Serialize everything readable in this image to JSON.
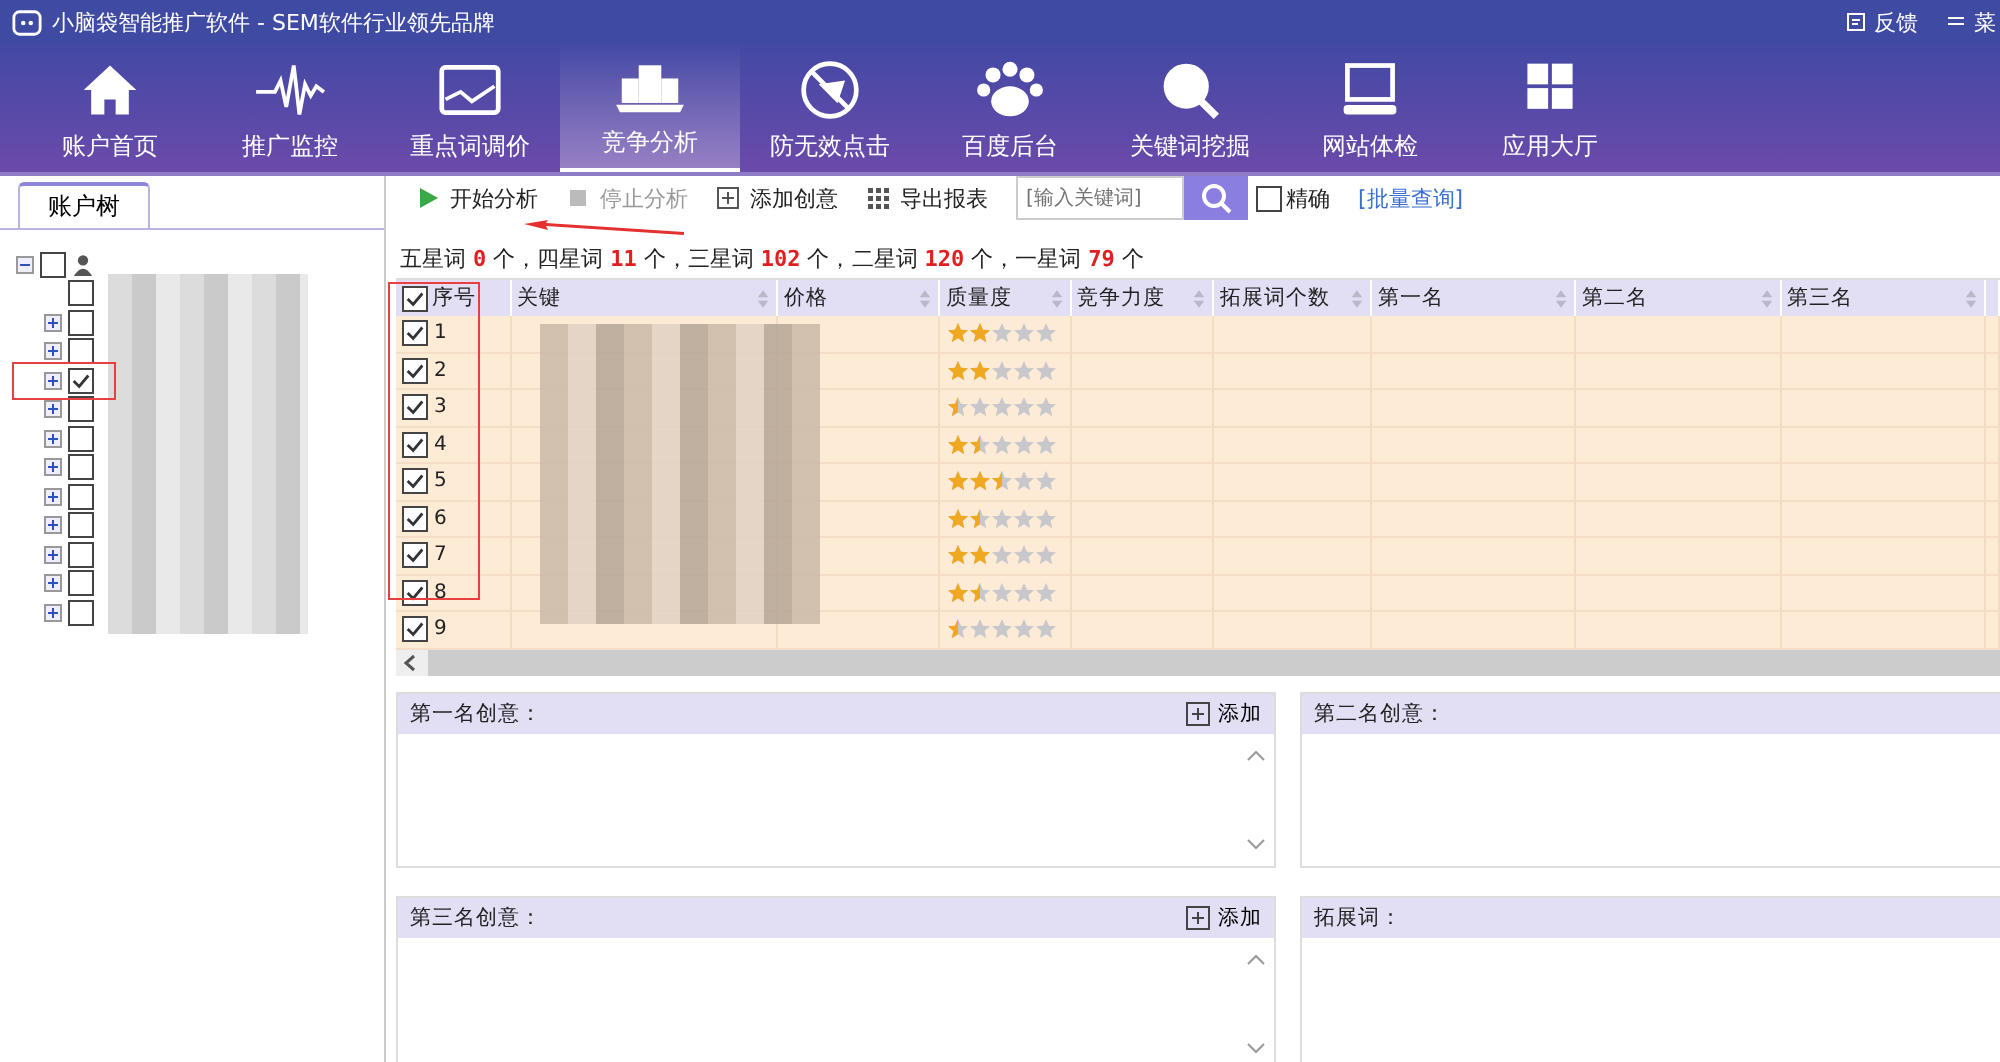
{
  "window": {
    "title": "小脑袋智能推广软件 - SEM软件行业领先品牌",
    "actions": [
      {
        "kind": "feedback",
        "label": "反馈"
      },
      {
        "kind": "menu",
        "label": "菜"
      }
    ]
  },
  "nav": [
    {
      "kind": "home",
      "label": "账户首页",
      "selected": false
    },
    {
      "kind": "pulse",
      "label": "推广监控",
      "selected": false
    },
    {
      "kind": "chart",
      "label": "重点词调价",
      "selected": false
    },
    {
      "kind": "podium",
      "label": "竞争分析",
      "selected": true
    },
    {
      "kind": "noclick",
      "label": "防无效点击",
      "selected": false
    },
    {
      "kind": "paw",
      "label": "百度后台",
      "selected": false
    },
    {
      "kind": "search",
      "label": "关键词挖掘",
      "selected": false
    },
    {
      "kind": "monitor",
      "label": "网站体检",
      "selected": false
    },
    {
      "kind": "apps",
      "label": "应用大厅",
      "selected": false
    }
  ],
  "sidebar": {
    "tab": "账户树",
    "root_checked": false,
    "items": [
      {
        "expandable": false,
        "checked": false
      },
      {
        "expandable": true,
        "checked": false
      },
      {
        "expandable": true,
        "checked": false
      },
      {
        "expandable": true,
        "checked": true
      },
      {
        "expandable": true,
        "checked": false
      },
      {
        "expandable": true,
        "checked": false
      },
      {
        "expandable": true,
        "checked": false
      },
      {
        "expandable": true,
        "checked": false
      },
      {
        "expandable": true,
        "checked": false
      },
      {
        "expandable": true,
        "checked": false
      },
      {
        "expandable": true,
        "checked": false
      },
      {
        "expandable": true,
        "checked": false
      }
    ]
  },
  "toolbar": {
    "buttons": [
      {
        "kind": "play",
        "label": "开始分析",
        "disabled": false
      },
      {
        "kind": "stop",
        "label": "停止分析",
        "disabled": true
      },
      {
        "kind": "add",
        "label": "添加创意",
        "disabled": false
      },
      {
        "kind": "grid",
        "label": "导出报表",
        "disabled": false
      }
    ],
    "search": {
      "placeholder": "[输入关键词]"
    },
    "exact": {
      "label": "精确",
      "checked": false
    },
    "batch_link": "[批量查询]"
  },
  "summary": [
    {
      "label": "五星词",
      "count": "0",
      "unit": "个，"
    },
    {
      "label": "四星词",
      "count": "11",
      "unit": "个，"
    },
    {
      "label": "三星词",
      "count": "102",
      "unit": "个，"
    },
    {
      "label": "二星词",
      "count": "120",
      "unit": "个，"
    },
    {
      "label": "一星词",
      "count": "79",
      "unit": "个"
    }
  ],
  "table": {
    "all_checked": true,
    "columns": [
      "序号",
      "关键",
      "价格",
      "质量度",
      "竞争力度",
      "拓展词个数",
      "第一名",
      "第二名",
      "第三名"
    ],
    "rows": [
      {
        "no": "1",
        "checked": true,
        "stars": 2
      },
      {
        "no": "2",
        "checked": true,
        "stars": 2
      },
      {
        "no": "3",
        "checked": true,
        "stars": 0.5
      },
      {
        "no": "4",
        "checked": true,
        "stars": 1.5
      },
      {
        "no": "5",
        "checked": true,
        "stars": 2.5
      },
      {
        "no": "6",
        "checked": true,
        "stars": 1.5
      },
      {
        "no": "7",
        "checked": true,
        "stars": 2
      },
      {
        "no": "8",
        "checked": true,
        "stars": 1.5
      },
      {
        "no": "9",
        "checked": true,
        "stars": 0.5
      }
    ]
  },
  "panels": [
    {
      "title": "第一名创意：",
      "add": "添加"
    },
    {
      "title": "第二名创意："
    },
    {
      "title": "第三名创意：",
      "add": "添加"
    },
    {
      "title": "拓展词："
    }
  ]
}
